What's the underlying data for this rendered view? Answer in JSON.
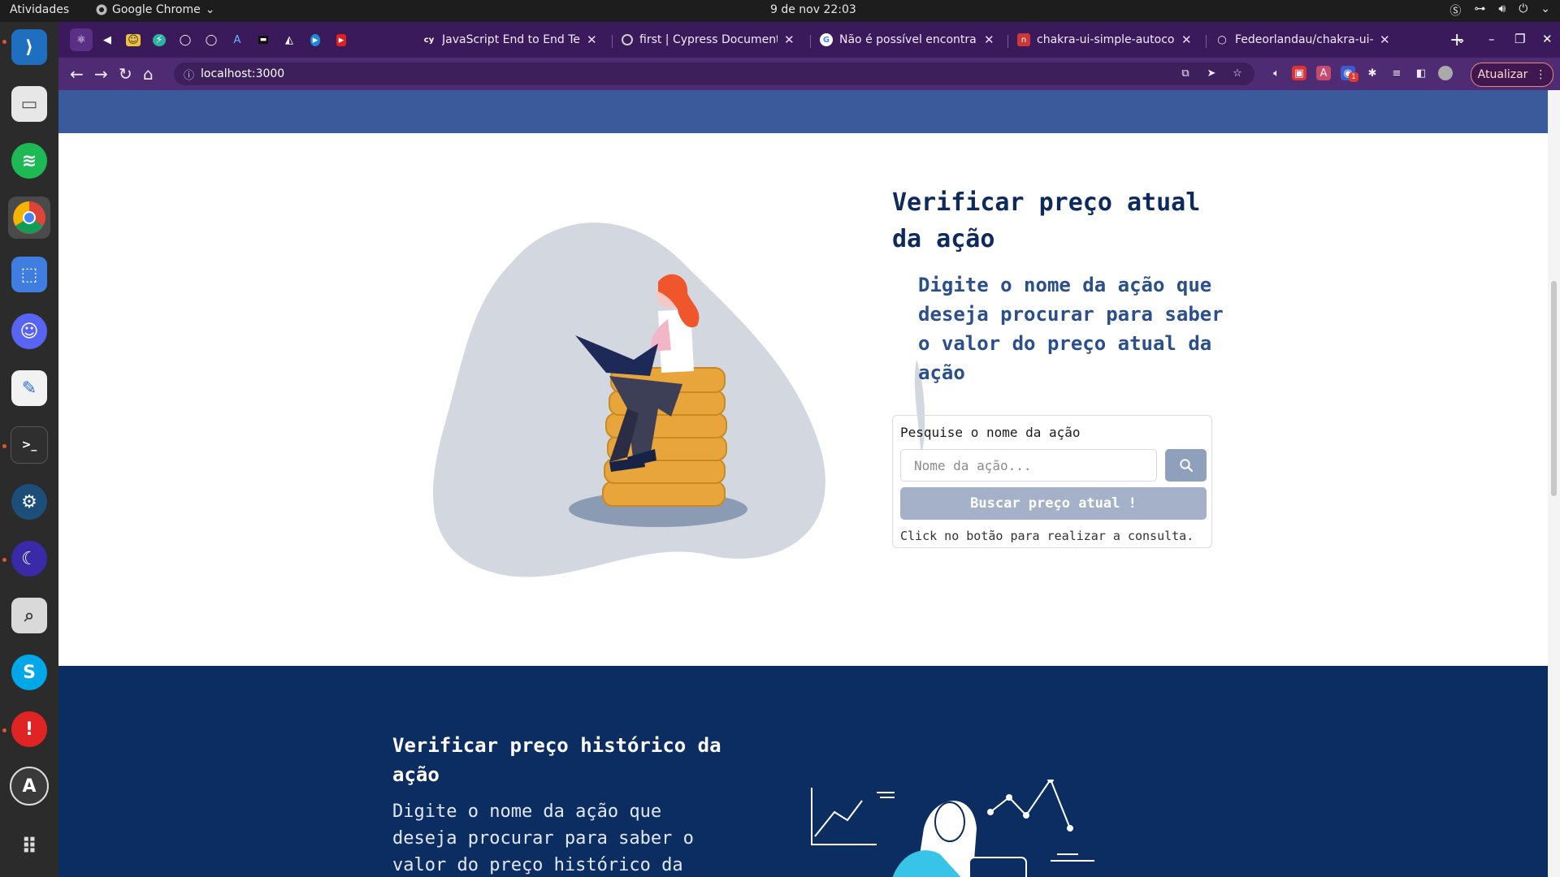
{
  "system": {
    "activities": "Atividades",
    "app_name": "Google Chrome",
    "clock": "9 de nov  22:03"
  },
  "browser": {
    "tabs": [
      {
        "title": "JavaScript End to End Te",
        "favicon": "cy"
      },
      {
        "title": "first | Cypress Documenta",
        "favicon": "spinner"
      },
      {
        "title": "Não é possível encontrar",
        "favicon": "G"
      },
      {
        "title": "chakra-ui-simple-autocon",
        "favicon": "n"
      },
      {
        "title": "Fedeorlandau/chakra-ui-",
        "favicon": "github-icon"
      }
    ],
    "url": "localhost:3000",
    "update_label": "Atualizar",
    "extension_badge": "1"
  },
  "page": {
    "current": {
      "title": "Verificar preço atual da ação",
      "description": "Digite o nome da ação que deseja procurar para saber o valor do preço atual da ação",
      "search_label": "Pesquise o nome da ação",
      "search_placeholder": "Nome da ação...",
      "search_value": "",
      "submit_label": "Buscar preço atual !",
      "helper_text": "Click no botão para realizar a consulta."
    },
    "historical": {
      "title": "Verificar preço histórico da ação",
      "description": "Digite o nome da ação que deseja procurar para saber o valor do preço histórico da"
    }
  },
  "colors": {
    "hero_band": "#3a5a9b",
    "dark_section": "#0c2d62",
    "title_text": "#0d2a5c",
    "button_bg": "#a5b1c8",
    "browser_frame": "#3b1a5c"
  }
}
